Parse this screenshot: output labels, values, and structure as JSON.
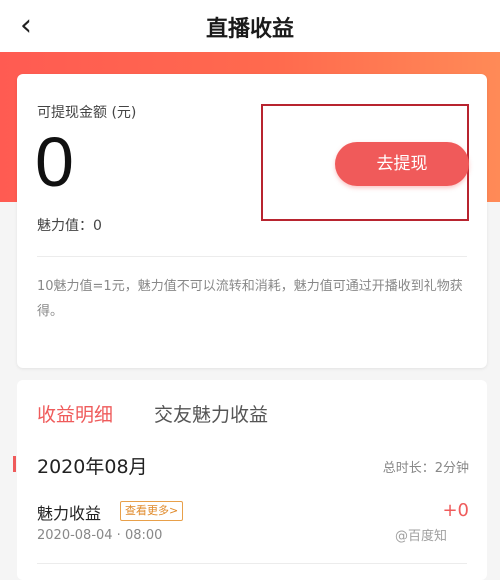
{
  "header": {
    "back_icon": "chevron-left-icon",
    "back_glyph": "‹",
    "title": "直播收益"
  },
  "balance_card": {
    "label": "可提现金额 (元)",
    "amount": "0",
    "charm": "魅力值：0",
    "withdraw_button": "去提现",
    "note": "10魅力值=1元，魅力值不可以流转和消耗，魅力值可通过开播收到礼物获得。"
  },
  "details": {
    "tabs": [
      {
        "label": "收益明细",
        "active": true
      },
      {
        "label": "交友魅力收益",
        "active": false
      }
    ],
    "month": "2020年08月",
    "total_duration": "总时长：2分钟",
    "records": [
      {
        "title": "魅力收益",
        "badge": "查看更多>",
        "value": "+0",
        "time": "2020-08-04 · 08:00"
      }
    ]
  },
  "watermark": "@百度知",
  "colors": {
    "accent": "#ef5b5b",
    "banner_start": "#ff5b52",
    "banner_end": "#ff8a57",
    "badge": "#e08a2a",
    "highlight_box": "#b8242f"
  }
}
